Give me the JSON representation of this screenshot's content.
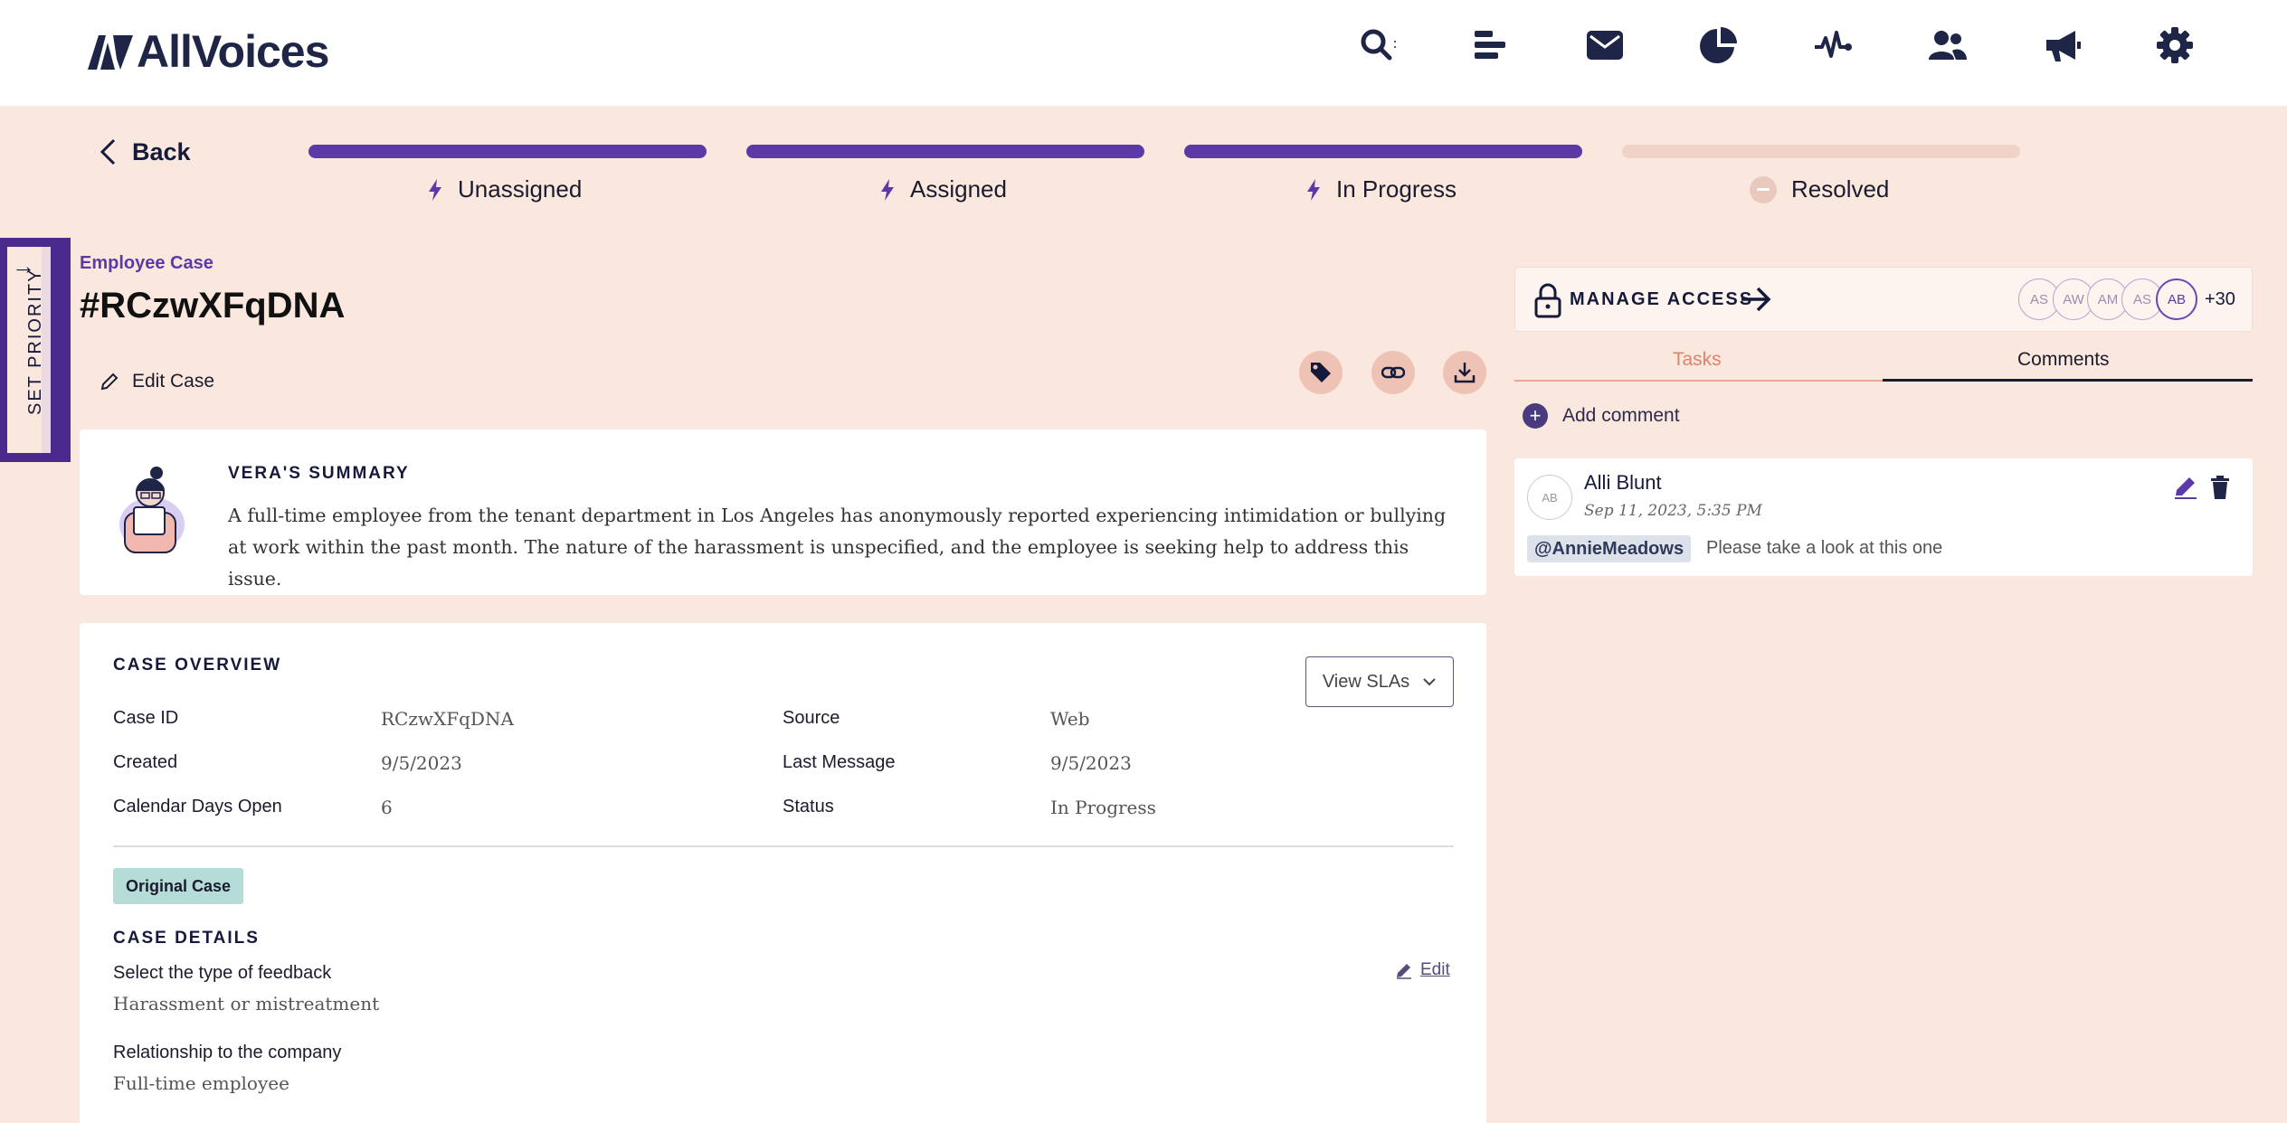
{
  "brand": {
    "name": "AllVoices",
    "color": "#1e2547",
    "accent": "#5b3aa8"
  },
  "nav": {
    "icons": [
      "search-icon",
      "list-icon",
      "mail-icon",
      "pie-chart-icon",
      "pulse-icon",
      "users-icon",
      "megaphone-icon",
      "gear-icon"
    ]
  },
  "back_label": "Back",
  "progress": {
    "steps": [
      {
        "label": "Unassigned",
        "done": true
      },
      {
        "label": "Assigned",
        "done": true
      },
      {
        "label": "In Progress",
        "done": true
      },
      {
        "label": "Resolved",
        "done": false
      }
    ]
  },
  "priority_tab": {
    "label": "SET PRIORITY"
  },
  "case": {
    "type": "Employee Case",
    "title": "#RCzwXFqDNA",
    "edit_label": "Edit Case"
  },
  "summary": {
    "title": "VERA'S SUMMARY",
    "text": "A full-time employee from the tenant department in Los Angeles has anonymously reported experiencing intimidation or bullying at work within the past month. The nature of the harassment is unspecified, and the employee is seeking help to address this issue."
  },
  "overview": {
    "title": "CASE OVERVIEW",
    "view_slas": "View SLAs",
    "fields": {
      "case_id_label": "Case ID",
      "case_id": "RCzwXFqDNA",
      "created_label": "Created",
      "created": "9/5/2023",
      "days_open_label": "Calendar Days Open",
      "days_open": "6",
      "source_label": "Source",
      "source": "Web",
      "last_message_label": "Last Message",
      "last_message": "9/5/2023",
      "status_label": "Status",
      "status": "In Progress"
    },
    "badge": "Original Case",
    "details_title": "CASE DETAILS",
    "details_edit": "Edit",
    "details": [
      {
        "question": "Select the type of feedback",
        "answer": "Harassment or mistreatment"
      },
      {
        "question": "Relationship to the company",
        "answer": "Full-time employee"
      }
    ]
  },
  "access": {
    "label": "MANAGE ACCESS",
    "avatars": [
      "AS",
      "AW",
      "AM",
      "AS",
      "AB"
    ],
    "more": "+30"
  },
  "tabs": {
    "tasks": "Tasks",
    "comments": "Comments",
    "active": "comments"
  },
  "add_comment": "Add comment",
  "comment": {
    "avatar": "AB",
    "author": "Alli Blunt",
    "date": "Sep 11, 2023, 5:35 PM",
    "mention": "@AnnieMeadows",
    "text": "Please take a look at this one"
  }
}
